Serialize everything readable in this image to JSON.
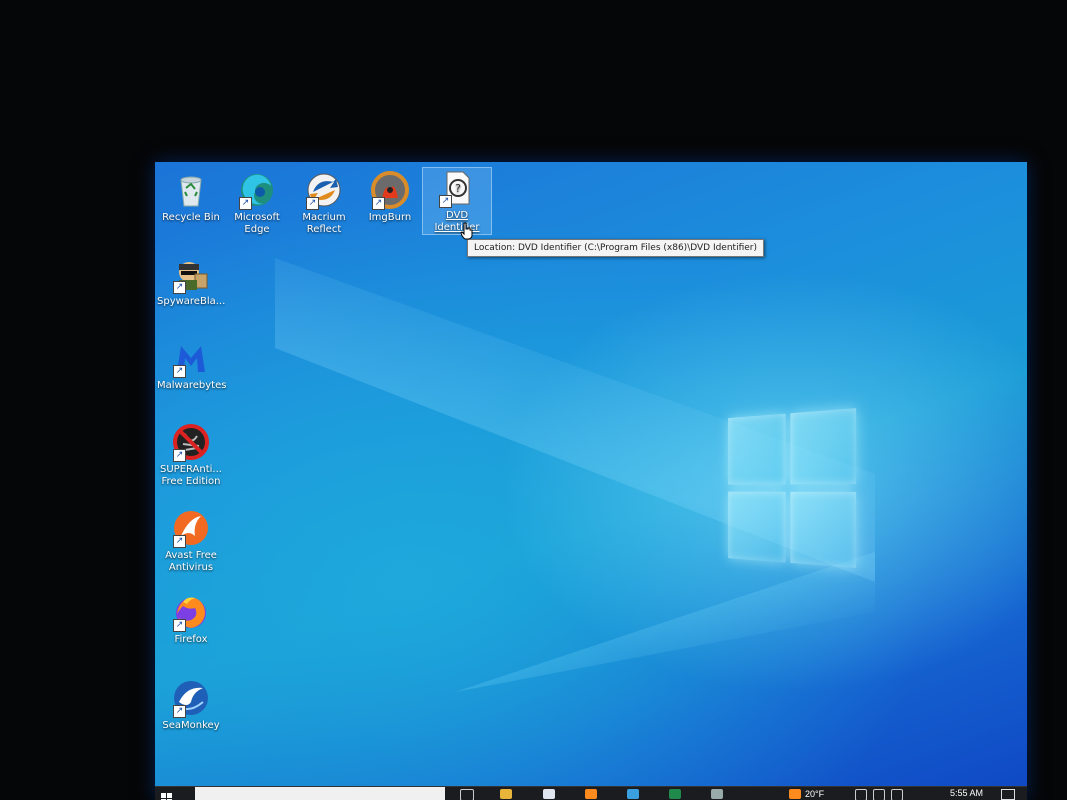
{
  "desktop": {
    "icons": [
      {
        "label": "Recycle Bin",
        "icon": "recycle-bin-icon"
      },
      {
        "label": "Microsoft Edge",
        "icon": "edge-icon"
      },
      {
        "label": "Macrium Reflect",
        "icon": "macrium-reflect-icon"
      },
      {
        "label": "ImgBurn",
        "icon": "imgburn-icon"
      },
      {
        "label": "DVD Identifier",
        "icon": "dvd-identifier-icon",
        "selected": true
      },
      {
        "label": "SpywareBla...",
        "icon": "spywareblaster-icon"
      },
      {
        "label": "Malwarebytes",
        "icon": "malwarebytes-icon"
      },
      {
        "label": "SUPERAnti... Free Edition",
        "icon": "superantispyware-icon"
      },
      {
        "label": "Avast Free Antivirus",
        "icon": "avast-icon"
      },
      {
        "label": "Firefox",
        "icon": "firefox-icon"
      },
      {
        "label": "SeaMonkey",
        "icon": "seamonkey-icon"
      }
    ],
    "tooltip": "Location: DVD Identifier (C:\\Program Files (x86)\\DVD Identifier)"
  },
  "taskbar": {
    "weather": "20°F",
    "clock": "5:55 AM",
    "pinned": [
      "task-view-icon",
      "file-explorer-icon",
      "calendar-icon",
      "photos-icon",
      "store-icon",
      "excel-icon",
      "chrome-icon",
      "firefox-icon"
    ]
  },
  "colors": {
    "wallpaper": "#1a8fdc",
    "taskbar": "#1b1c20",
    "tooltip_bg": "#f4f4f4"
  }
}
